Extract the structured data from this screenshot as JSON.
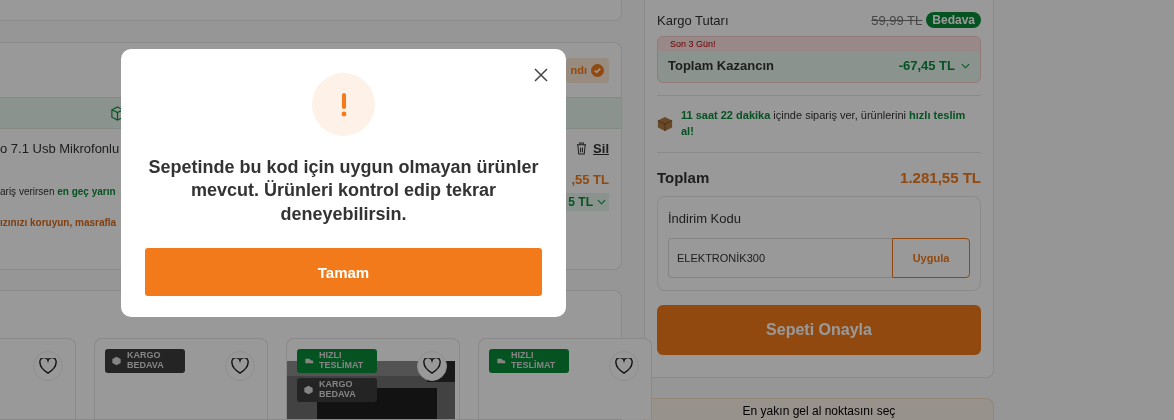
{
  "cart": {
    "top_card": true,
    "seller_badge": "ndı",
    "product": {
      "name": "o 7.1 Usb Mikrofonlu",
      "delete": "Sil",
      "price": ",55 TL",
      "saving": "5 TL"
    },
    "shipping_note": [
      {
        "text": "ariş verirsen ",
        "kind": "plain"
      },
      {
        "text": "en geç yarın",
        "kind": "highlight"
      }
    ],
    "warning_note": "ızınızı koruyun, masrafla"
  },
  "recommendations": [
    {
      "picture": false
    },
    {
      "badges": [
        {
          "kind": "cargo",
          "text": "KARGO BEDAVA"
        }
      ],
      "picture": false
    },
    {
      "badges": [
        {
          "kind": "fast",
          "text": "HIZLI TESLİMAT"
        },
        {
          "kind": "cargo",
          "text": "KARGO BEDAVA"
        }
      ],
      "picture": true
    },
    {
      "badges": [
        {
          "kind": "fast",
          "text": "HIZLI TESLİMAT"
        }
      ],
      "picture": false
    }
  ],
  "summary": {
    "shipping_label": "Kargo Tutarı",
    "shipping_old": "59,99 TL",
    "shipping_badge": "Bedava",
    "deal_tag": "Son 3 Gün!",
    "savings_label": "Toplam Kazancın",
    "savings_value": "-67,45 TL",
    "delivery_message": [
      {
        "text": "11 saat 22 dakika",
        "kind": "highlight"
      },
      {
        "text": " içinde sipariş ver, ürünlerini ",
        "kind": "plain"
      },
      {
        "text": "hızlı teslim al!",
        "kind": "highlight"
      }
    ],
    "total_label": "Toplam",
    "total_value": "1.281,55 TL",
    "coupon_label": "İndirim Kodu",
    "coupon_value": "ELEKTRONİK300",
    "apply_button": "Uygula",
    "confirm_button": "Sepeti Onayla",
    "pickup_text": "En yakın gel al noktasını seç"
  },
  "modal": {
    "message": "Sepetinde bu kod için uygun olmayan ürünler mevcut. Ürünleri kontrol edip tekrar deneyebilirsin.",
    "button": "Tamam"
  }
}
